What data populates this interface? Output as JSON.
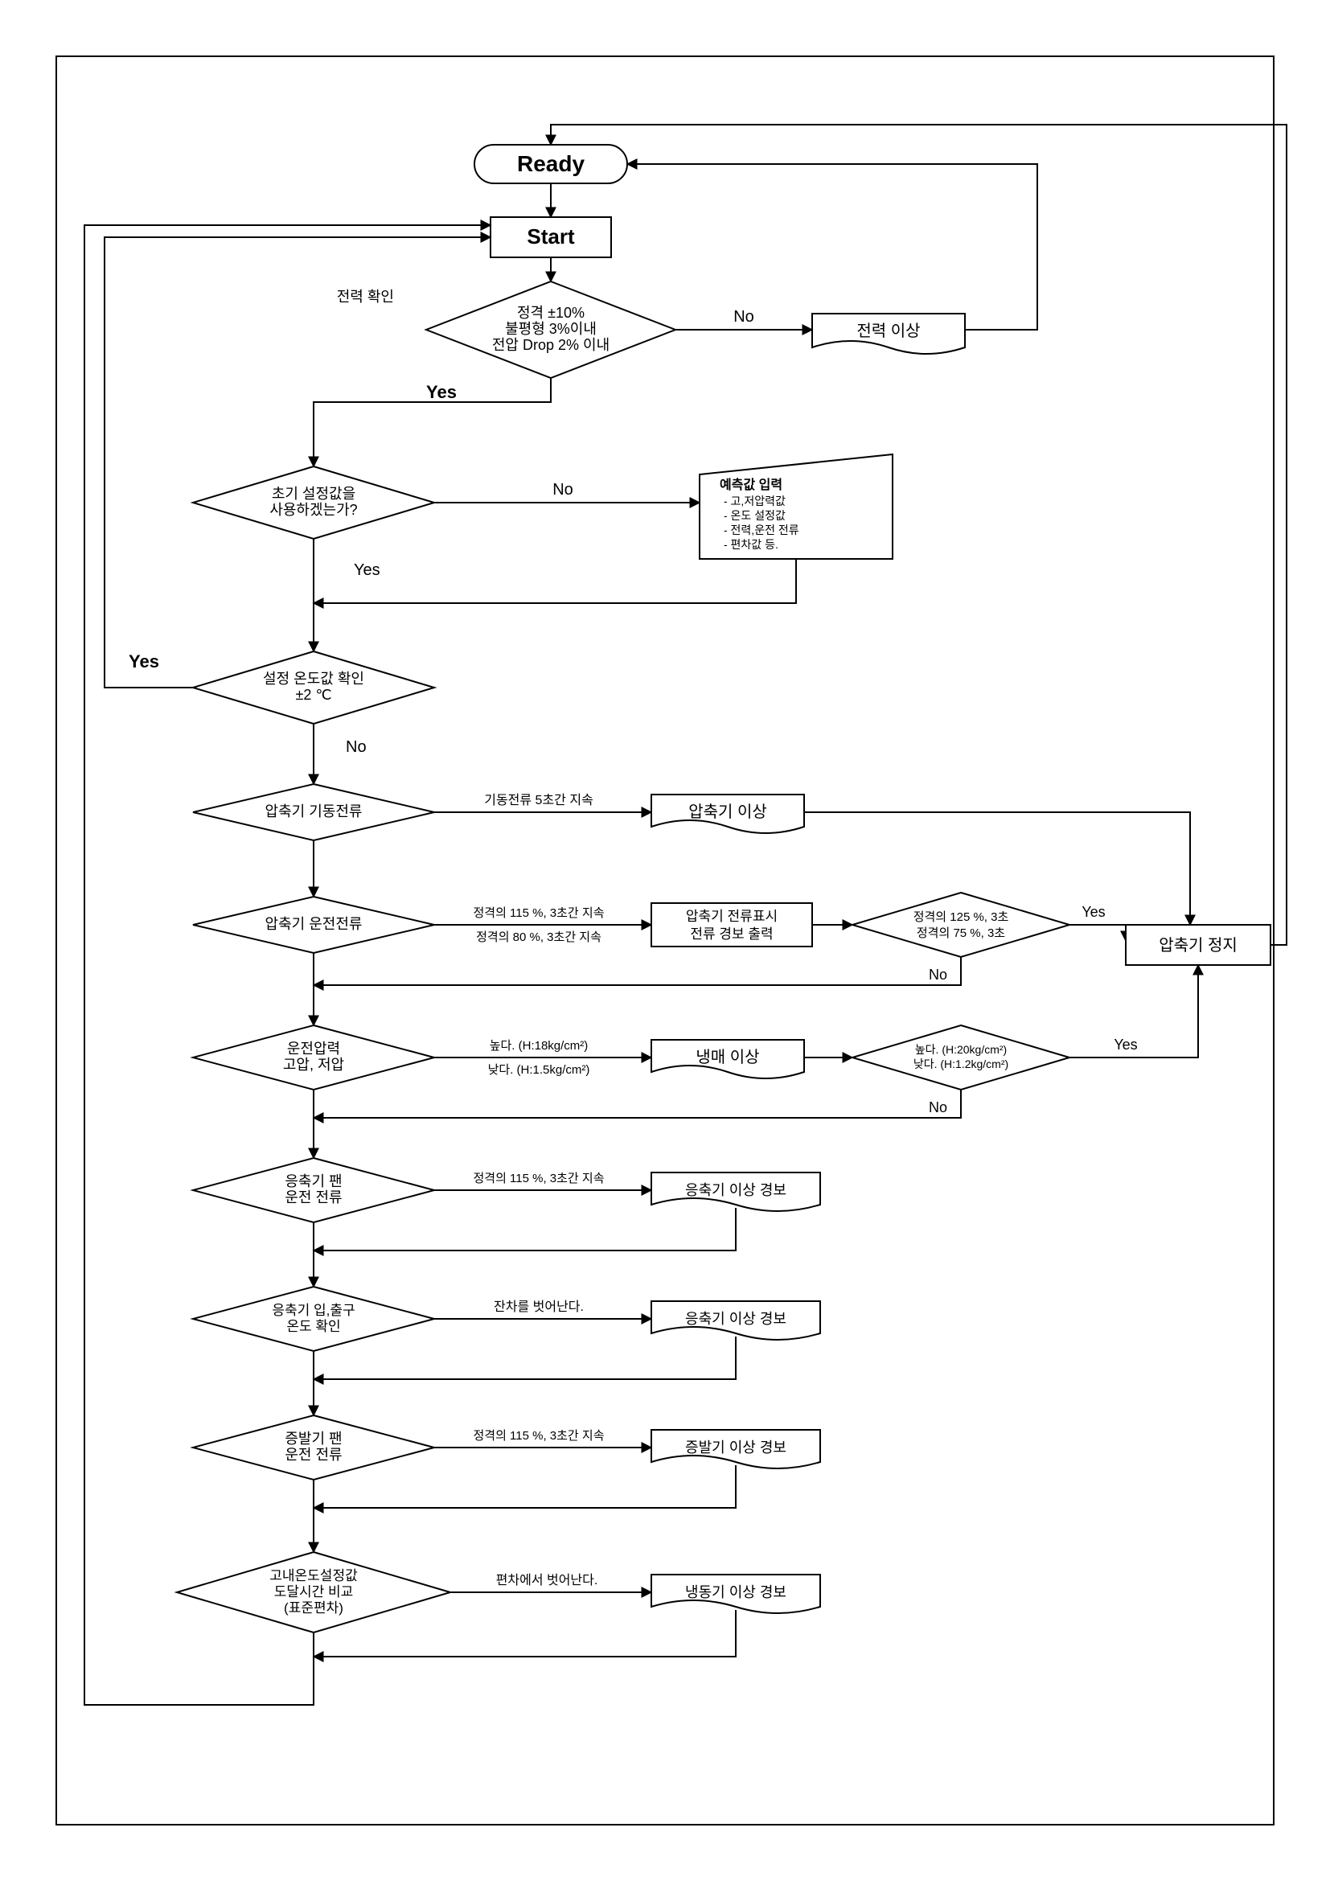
{
  "labels": {
    "ready": "Ready",
    "start": "Start",
    "power_check_label": "전력 확인",
    "power_check_line1": "정격 ±10%",
    "power_check_line2": "불평형 3%이내",
    "power_check_line3": "전압 Drop 2% 이내",
    "power_abnormal": "전력 이상",
    "initial_q_line1": "초기 설정값을",
    "initial_q_line2": "사용하겠는가?",
    "predict_title": "예측값 입력",
    "predict_l1": "- 고,저압력값",
    "predict_l2": "- 온도 설정값",
    "predict_l3": "- 전력,운전 전류",
    "predict_l4": "- 편차값 등.",
    "set_temp_line1": "설정 온도값 확인",
    "set_temp_line2": "±2 ℃",
    "comp_start_current": "압축기 기동전류",
    "start_current_5s": "기동전류 5초간 지속",
    "comp_abnormal": "압축기 이상",
    "comp_run_current": "압축기 운전전류",
    "run_115_3s": "정격의 115 %, 3초간 지속",
    "run_80_3s": "정격의 80 %, 3초간 지속",
    "current_disp_line1": "압축기 전류표시",
    "current_disp_line2": "전류 경보 출력",
    "rated_125_3s": "정격의 125 %, 3초",
    "rated_75_3s": "정격의 75 %, 3초",
    "comp_stop": "압축기 정지",
    "oper_press_line1": "운전압력",
    "oper_press_line2": "고압, 저압",
    "high_h18": "높다. (H:18kg/cm²)",
    "low_h15": "낮다. (H:1.5kg/cm²)",
    "refrigerant_abnormal": "냉매 이상",
    "high_h20": "높다. (H:20kg/cm²)",
    "low_h12": "낮다. (H:1.2kg/cm²)",
    "cond_fan_line1": "응축기 팬",
    "cond_fan_line2": "운전 전류",
    "cond_115_3s": "정격의 115 %, 3초간 지속",
    "cond_alarm": "응축기 이상 경보",
    "cond_io_line1": "응축기 입,출구",
    "cond_io_line2": "온도 확인",
    "temp_diff_out": "잔차를 벗어난다.",
    "evap_fan_line1": "증발기 팬",
    "evap_fan_line2": "운전 전류",
    "evap_115_3s": "정격의 115 %, 3초간 지속",
    "evap_alarm": "증발기 이상 경보",
    "final_line1": "고내온도설정값",
    "final_line2": "도달시간 비교",
    "final_line3": "(표준편차)",
    "dev_out": "편차에서 벗어난다.",
    "freeze_alarm": "냉동기 이상 경보",
    "yes": "Yes",
    "no": "No"
  },
  "chart_data": {
    "type": "flowchart",
    "nodes": [
      {
        "id": "ready",
        "shape": "terminator",
        "text": "Ready"
      },
      {
        "id": "start",
        "shape": "process",
        "text": "Start"
      },
      {
        "id": "d_power",
        "shape": "decision",
        "text": "정격 ±10% / 불평형 3%이내 / 전압 Drop 2% 이내",
        "label": "전력 확인"
      },
      {
        "id": "doc_power",
        "shape": "document",
        "text": "전력 이상"
      },
      {
        "id": "d_init",
        "shape": "decision",
        "text": "초기 설정값을 사용하겠는가?"
      },
      {
        "id": "input_predict",
        "shape": "manual-input",
        "text": "예측값 입력 - 고,저압력값 - 온도 설정값 - 전력,운전 전류 - 편차값 등."
      },
      {
        "id": "d_temp",
        "shape": "decision",
        "text": "설정 온도값 확인 ±2 ℃"
      },
      {
        "id": "d_start_cur",
        "shape": "decision",
        "text": "압축기 기동전류"
      },
      {
        "id": "doc_comp",
        "shape": "document",
        "text": "압축기 이상"
      },
      {
        "id": "d_run_cur",
        "shape": "decision",
        "text": "압축기 운전전류"
      },
      {
        "id": "p_cur_disp",
        "shape": "process",
        "text": "압축기 전류표시 전류 경보 출력"
      },
      {
        "id": "d_rated",
        "shape": "decision",
        "text": "정격의 125 %, 3초 / 정격의 75 %, 3초"
      },
      {
        "id": "p_stop",
        "shape": "process",
        "text": "압축기 정지"
      },
      {
        "id": "d_press",
        "shape": "decision",
        "text": "운전압력 고압, 저압"
      },
      {
        "id": "doc_ref",
        "shape": "document",
        "text": "냉매 이상"
      },
      {
        "id": "d_press2",
        "shape": "decision",
        "text": "높다.(H:20kg/cm²) / 낮다.(H:1.2kg/cm²)"
      },
      {
        "id": "d_cond_fan",
        "shape": "decision",
        "text": "응축기 팬 운전 전류"
      },
      {
        "id": "doc_cond1",
        "shape": "document",
        "text": "응축기 이상 경보"
      },
      {
        "id": "d_cond_io",
        "shape": "decision",
        "text": "응축기 입,출구 온도 확인"
      },
      {
        "id": "doc_cond2",
        "shape": "document",
        "text": "응축기 이상 경보"
      },
      {
        "id": "d_evap",
        "shape": "decision",
        "text": "증발기 팬 운전 전류"
      },
      {
        "id": "doc_evap",
        "shape": "document",
        "text": "증발기 이상 경보"
      },
      {
        "id": "d_final",
        "shape": "decision",
        "text": "고내온도설정값 도달시간 비교 (표준편차)"
      },
      {
        "id": "doc_freeze",
        "shape": "document",
        "text": "냉동기 이상 경보"
      }
    ],
    "edges": [
      {
        "from": "ready",
        "to": "start"
      },
      {
        "from": "start",
        "to": "d_power"
      },
      {
        "from": "d_power",
        "to": "doc_power",
        "label": "No"
      },
      {
        "from": "doc_power",
        "to": "ready"
      },
      {
        "from": "d_power",
        "to": "d_init",
        "label": "Yes"
      },
      {
        "from": "d_init",
        "to": "input_predict",
        "label": "No"
      },
      {
        "from": "d_init",
        "to": "d_temp",
        "label": "Yes"
      },
      {
        "from": "input_predict",
        "to": "d_temp"
      },
      {
        "from": "d_temp",
        "to": "start",
        "label": "Yes"
      },
      {
        "from": "d_temp",
        "to": "d_start_cur",
        "label": "No"
      },
      {
        "from": "d_start_cur",
        "to": "doc_comp",
        "label": "기동전류 5초간 지속"
      },
      {
        "from": "doc_comp",
        "to": "p_stop"
      },
      {
        "from": "d_start_cur",
        "to": "d_run_cur"
      },
      {
        "from": "d_run_cur",
        "to": "p_cur_disp",
        "label": "정격의 115 %, 3초간 지속 / 정격의 80 %, 3초간 지속"
      },
      {
        "from": "p_cur_disp",
        "to": "d_rated"
      },
      {
        "from": "d_rated",
        "to": "p_stop",
        "label": "Yes"
      },
      {
        "from": "d_rated",
        "to": "d_press",
        "label": "No"
      },
      {
        "from": "d_run_cur",
        "to": "d_press"
      },
      {
        "from": "d_press",
        "to": "doc_ref",
        "label": "높다.(H:18kg/cm²) / 낮다.(H:1.5kg/cm²)"
      },
      {
        "from": "doc_ref",
        "to": "d_press2"
      },
      {
        "from": "d_press2",
        "to": "p_stop",
        "label": "Yes"
      },
      {
        "from": "d_press2",
        "to": "d_cond_fan",
        "label": "No"
      },
      {
        "from": "d_press",
        "to": "d_cond_fan"
      },
      {
        "from": "d_cond_fan",
        "to": "doc_cond1",
        "label": "정격의 115 %, 3초간 지속"
      },
      {
        "from": "doc_cond1",
        "to": "d_cond_io"
      },
      {
        "from": "d_cond_fan",
        "to": "d_cond_io"
      },
      {
        "from": "d_cond_io",
        "to": "doc_cond2",
        "label": "잔차를 벗어난다."
      },
      {
        "from": "doc_cond2",
        "to": "d_evap"
      },
      {
        "from": "d_cond_io",
        "to": "d_evap"
      },
      {
        "from": "d_evap",
        "to": "doc_evap",
        "label": "정격의 115 %, 3초간 지속"
      },
      {
        "from": "doc_evap",
        "to": "d_final"
      },
      {
        "from": "d_evap",
        "to": "d_final"
      },
      {
        "from": "d_final",
        "to": "doc_freeze",
        "label": "편차에서 벗어난다."
      },
      {
        "from": "doc_freeze",
        "to": "start"
      },
      {
        "from": "d_final",
        "to": "start"
      },
      {
        "from": "p_stop",
        "to": "ready"
      }
    ]
  }
}
